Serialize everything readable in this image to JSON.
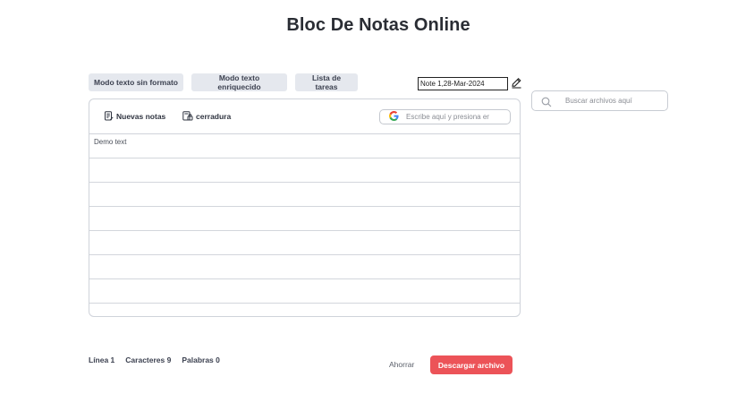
{
  "header": {
    "title": "Bloc De Notas Online"
  },
  "modes": {
    "plain": "Modo texto sin formato",
    "rich": "Modo texto enriquecido",
    "tasks": "Lista de tareas"
  },
  "note": {
    "name": "Note 1,28-Mar-2024"
  },
  "toolbar": {
    "new_notes": "Nuevas notas",
    "lock": "cerradura",
    "google_search_placeholder": "Escribe aquí y presiona er"
  },
  "editor": {
    "content": "Demo text"
  },
  "file_search": {
    "placeholder": "Buscar archivos aquí"
  },
  "stats": {
    "lines": "Línea 1",
    "chars": "Caracteres 9",
    "words": "Palabras 0"
  },
  "actions": {
    "save": "Ahorrar",
    "download": "Descargar archivo"
  },
  "colors": {
    "accent": "#ec5358",
    "mode_button_bg": "#e5e8ee",
    "border": "#cfd3da"
  },
  "icons": [
    "edit-pencil-icon",
    "new-note-icon",
    "lock-note-icon",
    "google-icon",
    "search-icon"
  ]
}
